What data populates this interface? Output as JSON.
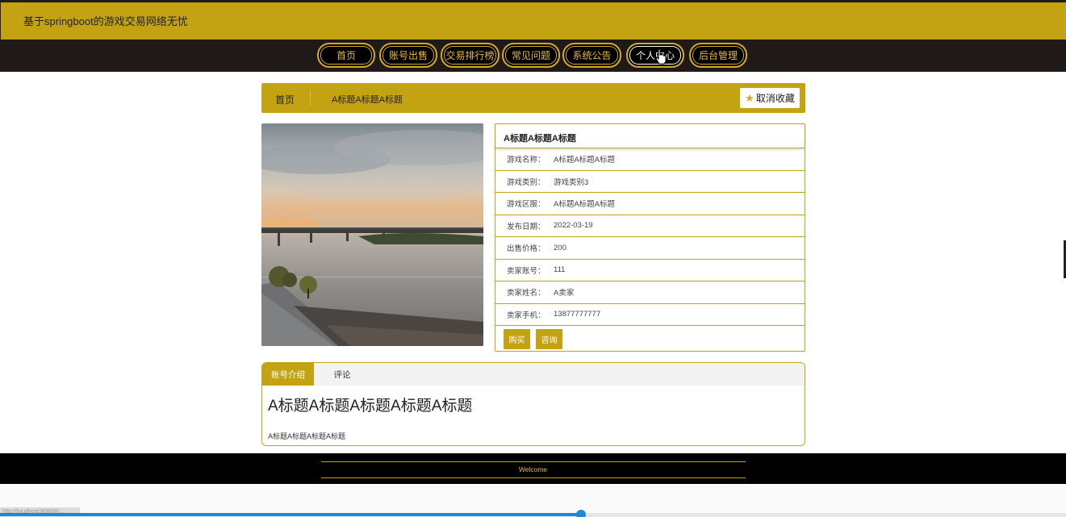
{
  "header": {
    "site_title": "基于springboot的游戏交易网络无忧"
  },
  "nav": {
    "items": [
      {
        "label": "首页"
      },
      {
        "label": "账号出售"
      },
      {
        "label": "交易排行榜"
      },
      {
        "label": "常见问题"
      },
      {
        "label": "系统公告"
      },
      {
        "label": "个人中心",
        "active": true
      },
      {
        "label": "后台管理"
      }
    ]
  },
  "breadcrumb": {
    "home": "首页",
    "current": "A标题A标题A标题",
    "fav_label": "取消收藏"
  },
  "detail": {
    "title": "A标题A标题A标题",
    "rows": [
      {
        "label": "游戏名称：",
        "value": "A标题A标题A标题"
      },
      {
        "label": "游戏类别：",
        "value": "游戏类别3"
      },
      {
        "label": "游戏区服：",
        "value": "A标题A标题A标题"
      },
      {
        "label": "发布日期：",
        "value": "2022-03-19"
      },
      {
        "label": "出售价格：",
        "value": "200"
      },
      {
        "label": "卖家账号：",
        "value": "111"
      },
      {
        "label": "卖家姓名：",
        "value": "A卖家"
      },
      {
        "label": "卖家手机：",
        "value": "13877777777"
      }
    ],
    "buy_label": "购买",
    "consult_label": "咨询"
  },
  "tabs": {
    "active_label": "账号介绍",
    "other_label": "评论",
    "content_heading": "A标题A标题A标题A标题A标题",
    "content_body": "A标题A标题A标题A标题"
  },
  "footer": {
    "text": "Welcome"
  },
  "browser": {
    "status_url": "http://localhost:8080/#/...",
    "progress": 0.545
  },
  "colors": {
    "accent": "#c4a312",
    "nav_bg": "#1f1a18",
    "nav_text": "#e8b838",
    "footer_bg": "#000000",
    "progress": "#1e88d8"
  }
}
